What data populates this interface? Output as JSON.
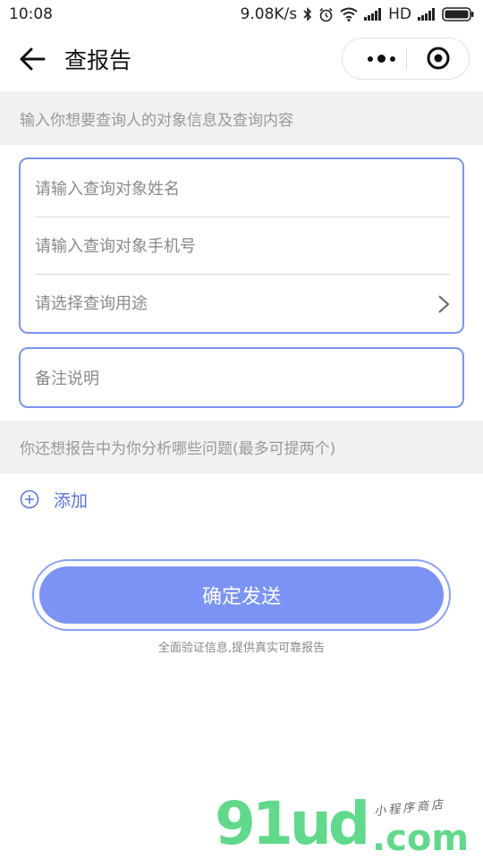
{
  "status_bar": {
    "time": "10:08",
    "net_speed": "9.08K/s",
    "network_type": "HD",
    "icons": [
      "bluetooth-icon",
      "alarm-icon",
      "wifi-icon",
      "signal-icon",
      "signal-icon",
      "battery-icon"
    ]
  },
  "nav": {
    "title": "查报告",
    "back_icon": "back-arrow-icon",
    "more_icon": "more-dots-icon",
    "close_icon": "target-close-icon"
  },
  "banner_top": "输入你想要查询人的对象信息及查询内容",
  "form": {
    "name_placeholder": "请输入查询对象姓名",
    "phone_placeholder": "请输入查询对象手机号",
    "purpose_placeholder": "请选择查询用途",
    "remark_placeholder": "备注说明"
  },
  "banner_questions": "你还想报告中为你分析哪些问题(最多可提两个)",
  "add_label": "添加",
  "confirm_label": "确定发送",
  "tagline": "全面验证信息,提供真实可靠报告",
  "watermark": {
    "main": "91ud",
    "com": ".com",
    "sub": "小程序商店"
  },
  "colors": {
    "accent": "#7b93f5",
    "border": "#7b93f2",
    "link": "#5a72e6",
    "banner_bg": "#f1f1f1",
    "watermark": "#5fd98a"
  }
}
